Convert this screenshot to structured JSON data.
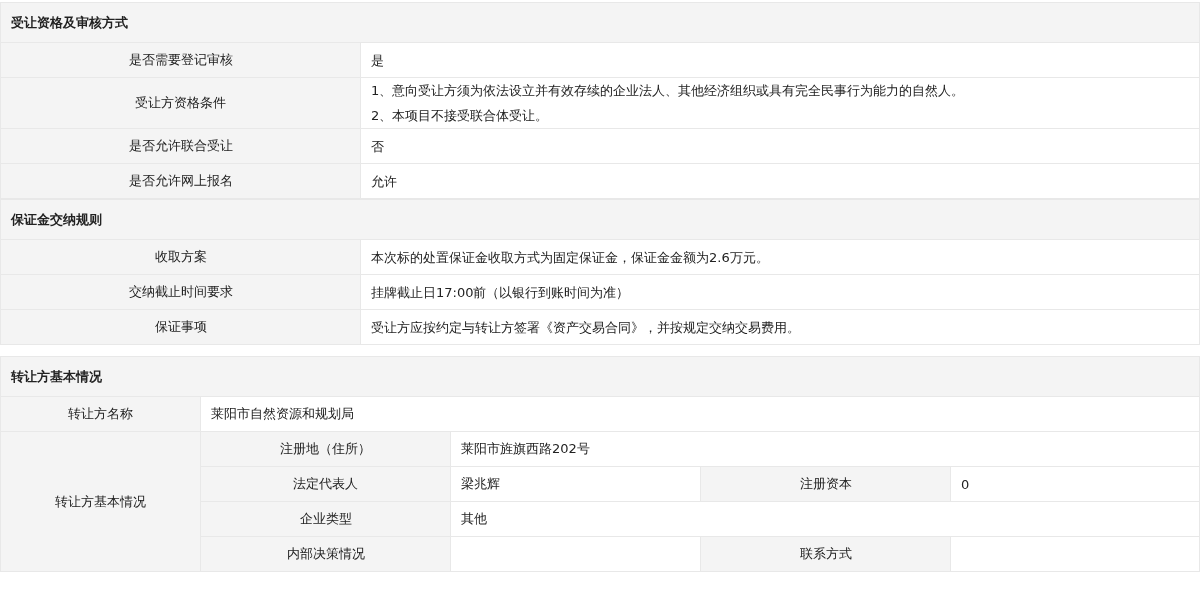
{
  "sections": [
    {
      "title": "受让资格及审核方式",
      "rows": [
        {
          "label": "是否需要登记审核",
          "values": [
            "是"
          ]
        },
        {
          "label": "受让方资格条件",
          "values": [
            "1、意向受让方须为依法设立并有效存续的企业法人、其他经济组织或具有完全民事行为能力的自然人。",
            "2、本项目不接受联合体受让。"
          ]
        },
        {
          "label": "是否允许联合受让",
          "values": [
            "否"
          ]
        },
        {
          "label": "是否允许网上报名",
          "values": [
            "允许"
          ]
        }
      ]
    },
    {
      "title": "保证金交纳规则",
      "rows": [
        {
          "label": "收取方案",
          "values": [
            "本次标的处置保证金收取方式为固定保证金，保证金金额为2.6万元。"
          ]
        },
        {
          "label": "交纳截止时间要求",
          "values": [
            "挂牌截止日17:00前（以银行到账时间为准）"
          ]
        },
        {
          "label": "保证事项",
          "values": [
            "受让方应按约定与转让方签署《资产交易合同》，并按规定交纳交易费用。"
          ]
        }
      ]
    }
  ],
  "transferor": {
    "title": "转让方基本情况",
    "name_row": {
      "label": "转让方名称",
      "value": "莱阳市自然资源和规划局"
    },
    "group": {
      "label": "转让方基本情况",
      "rows": [
        {
          "items": [
            {
              "label": "注册地（住所）",
              "value": "莱阳市旌旗西路202号"
            }
          ]
        },
        {
          "items": [
            {
              "label": "法定代表人",
              "value": "梁兆辉"
            },
            {
              "label": "注册资本",
              "value": "0"
            }
          ]
        },
        {
          "items": [
            {
              "label": "企业类型",
              "value": "其他"
            }
          ]
        },
        {
          "items": [
            {
              "label": "内部决策情况"
            },
            {
              "label": "联系方式"
            }
          ]
        }
      ]
    }
  }
}
